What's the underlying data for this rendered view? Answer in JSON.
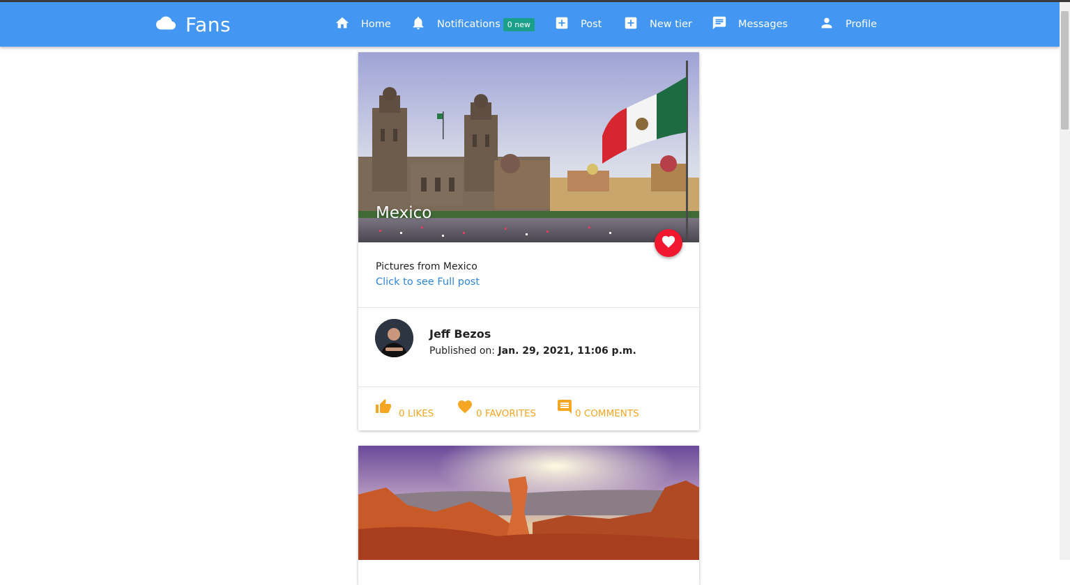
{
  "app": {
    "brand": "Fans"
  },
  "nav": {
    "home": "Home",
    "notifications": "Notifications",
    "notifications_badge": "0 new",
    "post": "Post",
    "new_tier": "New tier",
    "messages": "Messages",
    "profile": "Profile"
  },
  "posts": [
    {
      "title": "Mexico",
      "description": "Pictures from Mexico",
      "link": "Click to see Full post",
      "author": "Jeff Bezos",
      "published_label": "Published on:",
      "published_date": "Jan. 29, 2021, 11:06 p.m.",
      "likes": "0 LIKES",
      "favorites": "0 FAVORITES",
      "comments": "0 COMMENTS"
    }
  ],
  "colors": {
    "navbar": "#4397f2",
    "badge": "#1aa08a",
    "favorite_button": "#f0172e",
    "link": "#2f86d6",
    "action": "#f5a623"
  },
  "icons": {
    "brand": "cloud-icon",
    "home": "home-icon",
    "notifications": "bell-icon",
    "post": "add-box-icon",
    "new_tier": "add-box-icon",
    "messages": "message-icon",
    "profile": "person-icon",
    "favorite": "heart-icon",
    "likes": "thumb-up-icon",
    "favorites": "heart-icon",
    "comments": "comment-icon"
  }
}
